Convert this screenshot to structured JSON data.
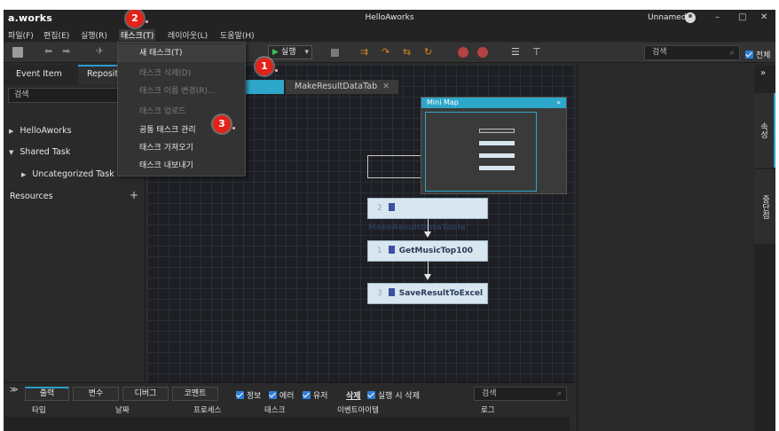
{
  "window": {
    "logo": "a.works",
    "title": "HelloAworks",
    "user": "Unnamed",
    "min": "–",
    "max": "□",
    "close": "✕"
  },
  "menubar": {
    "file": "파일(F)",
    "edit": "편집(E)",
    "run": "실행(R)",
    "task": "태스크(T)",
    "layout": "레이아웃(L)",
    "help": "도움말(H)"
  },
  "toolbar": {
    "run_label": "실행",
    "search_placeholder": "검색",
    "all_label": "전체"
  },
  "task_menu": {
    "items": [
      {
        "label": "새 태스크(T)",
        "enabled": true
      },
      {
        "label": "태스크 삭제(D)",
        "enabled": false
      },
      {
        "label": "태스크 이름 변경(R)...",
        "enabled": false
      },
      {
        "label": "태스크 업로드",
        "enabled": false
      },
      {
        "label": "공통 태스크 관리",
        "enabled": true
      },
      {
        "label": "태스크 가져오기",
        "enabled": true
      },
      {
        "label": "태스크 내보내기",
        "enabled": true
      }
    ]
  },
  "left_panel": {
    "tabs": [
      "Event Item",
      "Reposit"
    ],
    "search_placeholder": "검색",
    "tree": [
      "HelloAworks",
      "Shared Task",
      "Uncategorized Task"
    ],
    "resources": "Resources",
    "add": "+"
  },
  "canvas": {
    "tab": "MakeResultDataTab",
    "tab_close": "✕",
    "nodes": [
      {
        "num": "2",
        "label": "MakeResultDataTable"
      },
      {
        "num": "1",
        "label": "GetMusicTop100"
      },
      {
        "num": "3",
        "label": "SaveResultToExcel"
      }
    ],
    "minimap_title": "Mini Map",
    "minimap_collapse": "»"
  },
  "right_tabs": [
    "속성",
    "중단점"
  ],
  "right_collapse": "»",
  "bottom": {
    "tabs": [
      "출력",
      "변수",
      "디버그",
      "코멘트"
    ],
    "filters": [
      "정보",
      "에러",
      "유저"
    ],
    "delete": "삭제",
    "delete_on_run": "실행 시 삭제",
    "search_placeholder": "검색",
    "columns": [
      "타입",
      "날짜",
      "프로세스",
      "태스크",
      "이벤트아이템",
      "로그"
    ]
  },
  "badges": [
    "2",
    "1",
    "3"
  ],
  "colors": {
    "accent": "#2da6c9",
    "badge": "#e2231a",
    "node": "#d7e6ef",
    "run_icon": "#3fc35a"
  }
}
